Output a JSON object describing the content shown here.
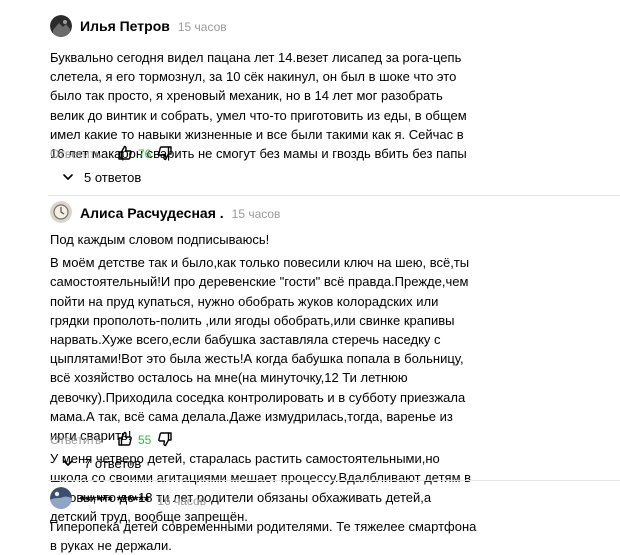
{
  "comments": [
    {
      "author": "Илья Петров",
      "time": "15 часов",
      "paragraphs": [
        "Буквально сегодня видел пацана лет 14.везет лисапед за рога-цепь слетела, я его тормознул, за 10 сёк накинул, он был в шоке что это было так просто, я хреновый механик, но в 14 лет мог разобрать велик до винтик и собрать, умел что-то приготовить из еды, в общем имел какие то навыки жизненные и все были такими как я. Сейчас в 16 лет макарон сварить не смогут без мамы и гвоздь вбить без папы"
      ],
      "reply_label": "Ответить",
      "likes": "76",
      "replies_label": "5 ответов"
    },
    {
      "author": "Алиса Расчудесная .",
      "time": "15 часов",
      "paragraphs": [
        "Под каждым словом подписываюсь!",
        "В моём детстве так и было,как только повесили ключ на шею, всё,ты самостоятельный!И про деревенские \"гости\" всё правда.Прежде,чем пойти на пруд купаться, нужно обобрать жуков колорадских или грядки прополоть-полить ,или ягоды обобрать,или свинке крапивы нарвать.Хуже всего,если бабушка заставляла стеречь наседку с цыплятами!Вот это была жесть!А когда бабушка попала в больницу, всё хозяйство осталось на мне(на минуточку,12 Ти летнюю девочку).Приходила соседка контролировать и в субботу приезжала мама.А так, всё сама делала.Даже измудрилась,тогда, варенье из ирги сварить!",
        "У меня четверо детей, старалась растить самостоятельными,но школа со своими агитациями мешает процессу.Вдалбливают детям в головы,что до 18 ти лет родители обязаны обхаживать детей,а детский труд, вообще запрещён."
      ],
      "reply_label": "Ответить",
      "likes": "55",
      "replies_label": "7 ответов"
    },
    {
      "author": "****** ******",
      "time": "16 часов",
      "paragraphs": [
        "Гиперопека детей современными родителями. Те тяжелее смартфона в руках не держали."
      ]
    }
  ],
  "icons": {
    "like": "thumbs-up-icon",
    "dislike": "thumbs-down-icon",
    "chevron": "chevron-down-icon"
  },
  "colors": {
    "likes": "#3cb545",
    "muted": "#9a9a9a"
  }
}
